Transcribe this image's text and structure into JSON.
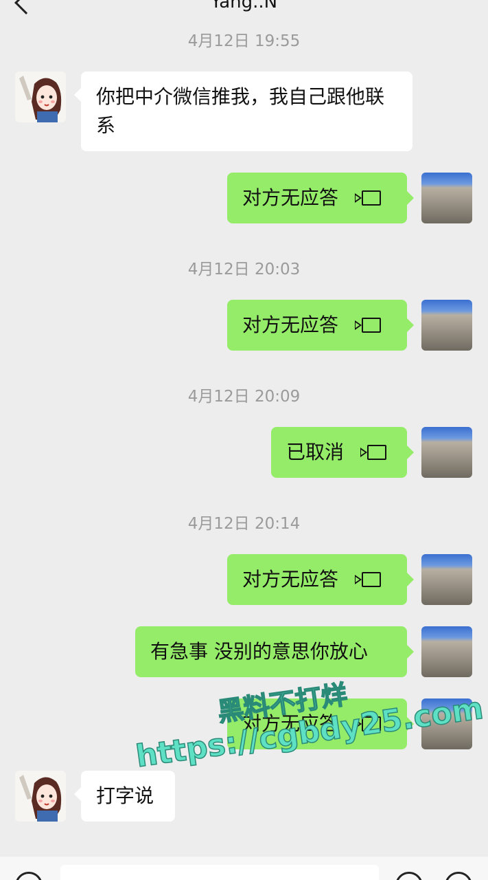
{
  "header": {
    "title": "Yang..N"
  },
  "messages": [
    {
      "type": "timestamp",
      "text": "4月12日 19:55"
    },
    {
      "type": "text",
      "side": "in",
      "text": "你把中介微信推我，我自己跟他联系"
    },
    {
      "type": "call",
      "side": "out",
      "text": "对方无应答"
    },
    {
      "type": "timestamp",
      "text": "4月12日 20:03"
    },
    {
      "type": "call",
      "side": "out",
      "text": "对方无应答"
    },
    {
      "type": "timestamp",
      "text": "4月12日 20:09"
    },
    {
      "type": "call",
      "side": "out",
      "text": "已取消"
    },
    {
      "type": "timestamp",
      "text": "4月12日 20:14"
    },
    {
      "type": "call",
      "side": "out",
      "text": "对方无应答"
    },
    {
      "type": "text",
      "side": "out",
      "text": "有急事 没别的意思你放心"
    },
    {
      "type": "call",
      "side": "out",
      "text": "对方无应答"
    },
    {
      "type": "text",
      "side": "in",
      "text": "打字说"
    }
  ],
  "watermark": {
    "line1": "黑料不打烊",
    "line2": "https://cgbdy25.com"
  },
  "colors": {
    "background": "#ededed",
    "outgoing_bubble": "#95ec69",
    "incoming_bubble": "#ffffff",
    "timestamp": "#9a9a9a"
  },
  "icons": {
    "back": "back-arrow-icon",
    "more": "more-icon",
    "call": "video-call-icon"
  }
}
